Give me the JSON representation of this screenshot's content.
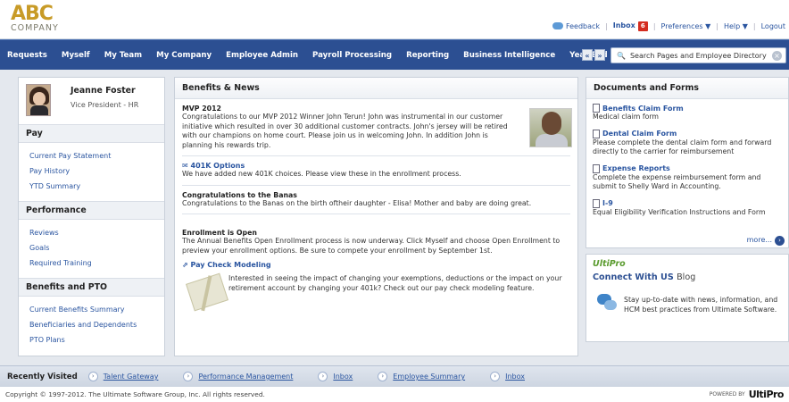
{
  "header": {
    "logo_abc": "ABC",
    "logo_company": "COMPANY",
    "feedback": "Feedback",
    "inbox": "Inbox",
    "inbox_count": "6",
    "preferences": "Preferences ▼",
    "help": "Help ▼",
    "logout": "Logout"
  },
  "nav": {
    "items": [
      "Requests",
      "Myself",
      "My Team",
      "My Company",
      "Employee Admin",
      "Payroll Processing",
      "Reporting",
      "Business Intelligence",
      "Year End"
    ],
    "prev": "«",
    "next": "»",
    "search_placeholder": "Search Pages and Employee Directory"
  },
  "profile": {
    "name": "Jeanne Foster",
    "title": "Vice President - HR"
  },
  "left": {
    "pay_title": "Pay",
    "pay_links": [
      "Current Pay Statement",
      "Pay History",
      "YTD Summary"
    ],
    "performance_title": "Performance",
    "performance_links": [
      "Reviews",
      "Goals",
      "Required Training"
    ],
    "benefits_title": "Benefits and PTO",
    "benefits_links": [
      "Current Benefits Summary",
      "Beneficiaries and Dependents",
      "PTO Plans"
    ]
  },
  "news": {
    "title": "Benefits & News",
    "mvp_title": "MVP 2012",
    "mvp_text": "Congratulations to our MVP 2012 Winner John Terun! John was instrumental in our customer initiative which resulted in over 30 additional customer contracts. John's jersey will be retired with our champions on home court. Please join us in welcoming John. In addition John is planning his rewards trip.",
    "k401_title": "401K Options",
    "k401_text": "We have added new 401K choices. Please view these in the enrollment process.",
    "banas_title": "Congratulations to the Banas",
    "banas_text": "Congratulations to the Banas on the birth oftheir daughter - Elisa! Mother and baby are doing great.",
    "enroll_title": "Enrollment is Open",
    "enroll_text": "The Annual Benefits Open Enrollment process is now underway. Click Myself and choose Open Enrollment to preview your enrollment options. Be sure to compete your enrollment by September 1st.",
    "pcm_title": "Pay Check Modeling",
    "pcm_text": "Interested in seeing the impact of changing your exemptions, deductions or the impact on your retirement account by changing your 401k? Check out our pay check modeling feature."
  },
  "documents": {
    "title": "Documents and Forms",
    "items": [
      {
        "title": "Benefits Claim Form",
        "desc": "Medical claim form"
      },
      {
        "title": "Dental Claim Form",
        "desc": "Please complete the dental claim form and forward directly to the carrier for reimbursement"
      },
      {
        "title": "Expense Reports",
        "desc": "Complete the expense reimbursement form and submit to Shelly Ward in Accounting."
      },
      {
        "title": "I-9",
        "desc": "Equal Eligibility Verification Instructions and Form"
      }
    ],
    "more": "more..."
  },
  "ultipro": {
    "brand": "UltiPro",
    "connect": "Connect With US",
    "blog": "Blog",
    "text": "Stay up-to-date with news, information, and HCM best practices from Ultimate Software."
  },
  "recent": {
    "label": "Recently Visited",
    "items": [
      "Talent Gateway",
      "Performance Management",
      "Inbox",
      "Employee Summary",
      "Inbox"
    ]
  },
  "footer": {
    "copyright": "Copyright © 1997-2012. The Ultimate Software Group, Inc. All rights reserved.",
    "powered_by": "POWERED BY",
    "powered_brand": "UltiPro"
  }
}
